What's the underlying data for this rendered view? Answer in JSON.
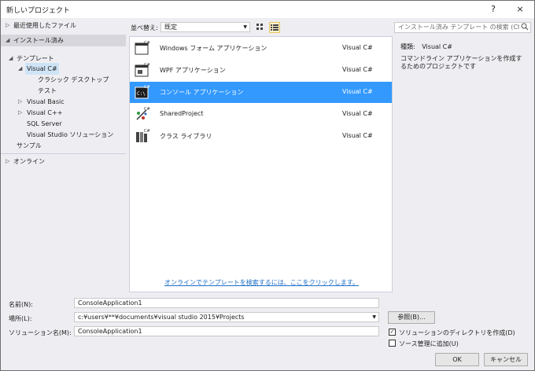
{
  "window": {
    "title": "新しいプロジェクト",
    "help_label": "?",
    "close_label": "×"
  },
  "nav": {
    "recent": "最近使用したファイル",
    "installed": "インストール済み",
    "templates": "テンプレート",
    "visual_csharp": "Visual C#",
    "classic_desktop": "クラシック デスクトップ",
    "test": "テスト",
    "visual_basic": "Visual Basic",
    "visual_cpp": "Visual C++",
    "sql_server": "SQL Server",
    "vs_solution": "Visual Studio ソリューション",
    "samples": "サンプル",
    "online": "オンライン"
  },
  "toolbar": {
    "sort_label": "並べ替え:",
    "sort_value": "既定",
    "search_placeholder": "インストール済み テンプレート の検索 (Ctrl+E"
  },
  "templates": [
    {
      "name": "Windows フォーム アプリケーション",
      "lang": "Visual C#"
    },
    {
      "name": "WPF アプリケーション",
      "lang": "Visual C#"
    },
    {
      "name": "コンソール アプリケーション",
      "lang": "Visual C#"
    },
    {
      "name": "SharedProject",
      "lang": "Visual C#"
    },
    {
      "name": "クラス ライブラリ",
      "lang": "Visual C#"
    }
  ],
  "online_link": "オンラインでテンプレートを検索するには、ここをクリックします。",
  "details": {
    "type_label": "種類:",
    "type_value": "Visual C#",
    "description": "コマンドライン アプリケーションを作成するためのプロジェクトです"
  },
  "form": {
    "name_label": "名前(N):",
    "name_value": "ConsoleApplication1",
    "location_label": "場所(L):",
    "location_value": "c:¥users¥**¥documents¥visual studio 2015¥Projects",
    "solution_label": "ソリューション名(M):",
    "solution_value": "ConsoleApplication1",
    "browse_label": "参照(B)...",
    "create_dir_label": "ソリューションのディレクトリを作成(D)",
    "source_control_label": "ソース管理に追加(U)",
    "ok_label": "OK",
    "cancel_label": "キャンセル"
  },
  "colors": {
    "accent": "#3399ff",
    "link": "#1e70c8",
    "panel_bg": "#eeeef2"
  }
}
